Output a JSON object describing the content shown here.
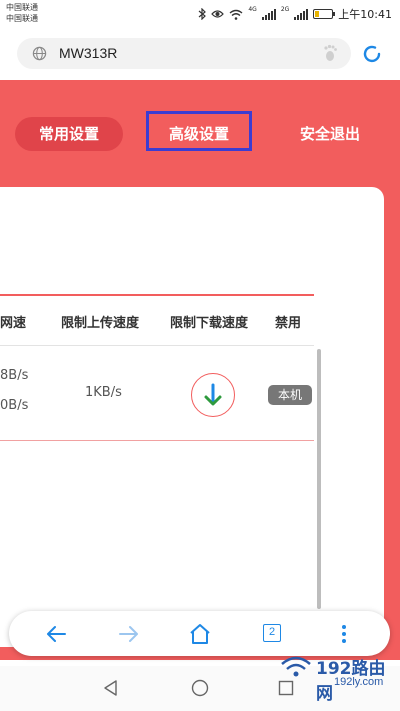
{
  "status_bar": {
    "carrier_1": "中国联通",
    "carrier_2": "中国联通",
    "network_1": "4G",
    "network_2": "2G",
    "time": "上午10:41",
    "icons": [
      "bluetooth-icon",
      "eye-icon",
      "wifi-icon",
      "signal-icon",
      "battery-icon"
    ]
  },
  "address_bar": {
    "url": "MW313R",
    "icons": [
      "globe-icon",
      "footprint-icon",
      "refresh-icon"
    ]
  },
  "nav": {
    "common_settings": "常用设置",
    "advanced_settings": "高级设置",
    "logout": "安全退出"
  },
  "table": {
    "headers": [
      "网速",
      "限制上传速度",
      "限制下载速度",
      "禁用"
    ],
    "row": {
      "speed_1": "8B/s",
      "speed_2": "0B/s",
      "upload_limit": "1KB/s",
      "download_icon": "download-arrow-icon",
      "badge": "本机"
    }
  },
  "toolbar": {
    "tabs_count": "2",
    "icons": [
      "back-arrow-icon",
      "forward-arrow-icon",
      "home-icon",
      "tabs-icon",
      "more-menu-icon"
    ]
  },
  "watermark": {
    "brand": "192路由网",
    "url": "192ly.com"
  },
  "colors": {
    "header_red": "#f25d5d",
    "active_pill": "#e0444a",
    "highlight_box": "#3c3cd2",
    "accent_blue": "#1e88e5"
  }
}
